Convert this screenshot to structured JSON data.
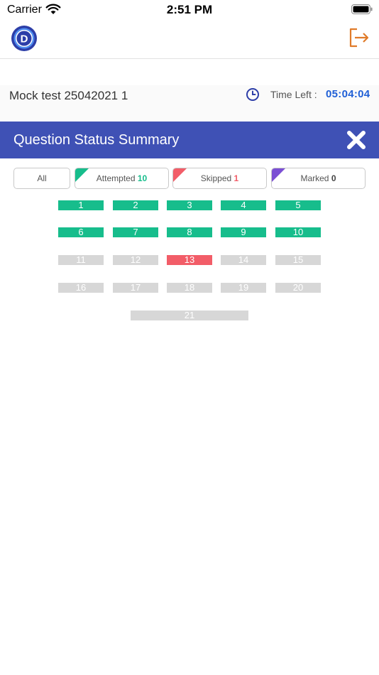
{
  "status_bar": {
    "carrier": "Carrier",
    "time": "2:51 PM",
    "wifi_icon": "wifi-icon",
    "battery_icon": "battery-icon"
  },
  "header": {
    "logo_letter": "D",
    "logo_color": "#2d3ea8",
    "logout_icon": "logout-icon",
    "logout_color": "#e07b2a"
  },
  "test": {
    "title": "Mock test 25042021 1",
    "clock_icon": "clock-icon",
    "time_left_label": "Time Left :",
    "time_left_value": "05:04:04"
  },
  "summary": {
    "title": "Question Status Summary",
    "close_icon": "close-icon",
    "bar_color": "#3f51b5"
  },
  "filters": {
    "all": {
      "label": "All"
    },
    "attempted": {
      "label": "Attempted",
      "count": "10",
      "color": "#17bd8c"
    },
    "skipped": {
      "label": "Skipped",
      "count": "1",
      "color": "#f25d68"
    },
    "marked": {
      "label": "Marked",
      "count": "0",
      "color": "#7b4fd4"
    }
  },
  "questions": [
    {
      "number": "1",
      "status": "attempted"
    },
    {
      "number": "2",
      "status": "attempted"
    },
    {
      "number": "3",
      "status": "attempted"
    },
    {
      "number": "4",
      "status": "attempted"
    },
    {
      "number": "5",
      "status": "attempted"
    },
    {
      "number": "6",
      "status": "attempted"
    },
    {
      "number": "7",
      "status": "attempted"
    },
    {
      "number": "8",
      "status": "attempted"
    },
    {
      "number": "9",
      "status": "attempted"
    },
    {
      "number": "10",
      "status": "attempted"
    },
    {
      "number": "11",
      "status": "unvisited"
    },
    {
      "number": "12",
      "status": "unvisited"
    },
    {
      "number": "13",
      "status": "skipped"
    },
    {
      "number": "14",
      "status": "unvisited"
    },
    {
      "number": "15",
      "status": "unvisited"
    },
    {
      "number": "16",
      "status": "unvisited"
    },
    {
      "number": "17",
      "status": "unvisited"
    },
    {
      "number": "18",
      "status": "unvisited"
    },
    {
      "number": "19",
      "status": "unvisited"
    },
    {
      "number": "20",
      "status": "unvisited"
    },
    {
      "number": "21",
      "status": "unvisited"
    }
  ]
}
